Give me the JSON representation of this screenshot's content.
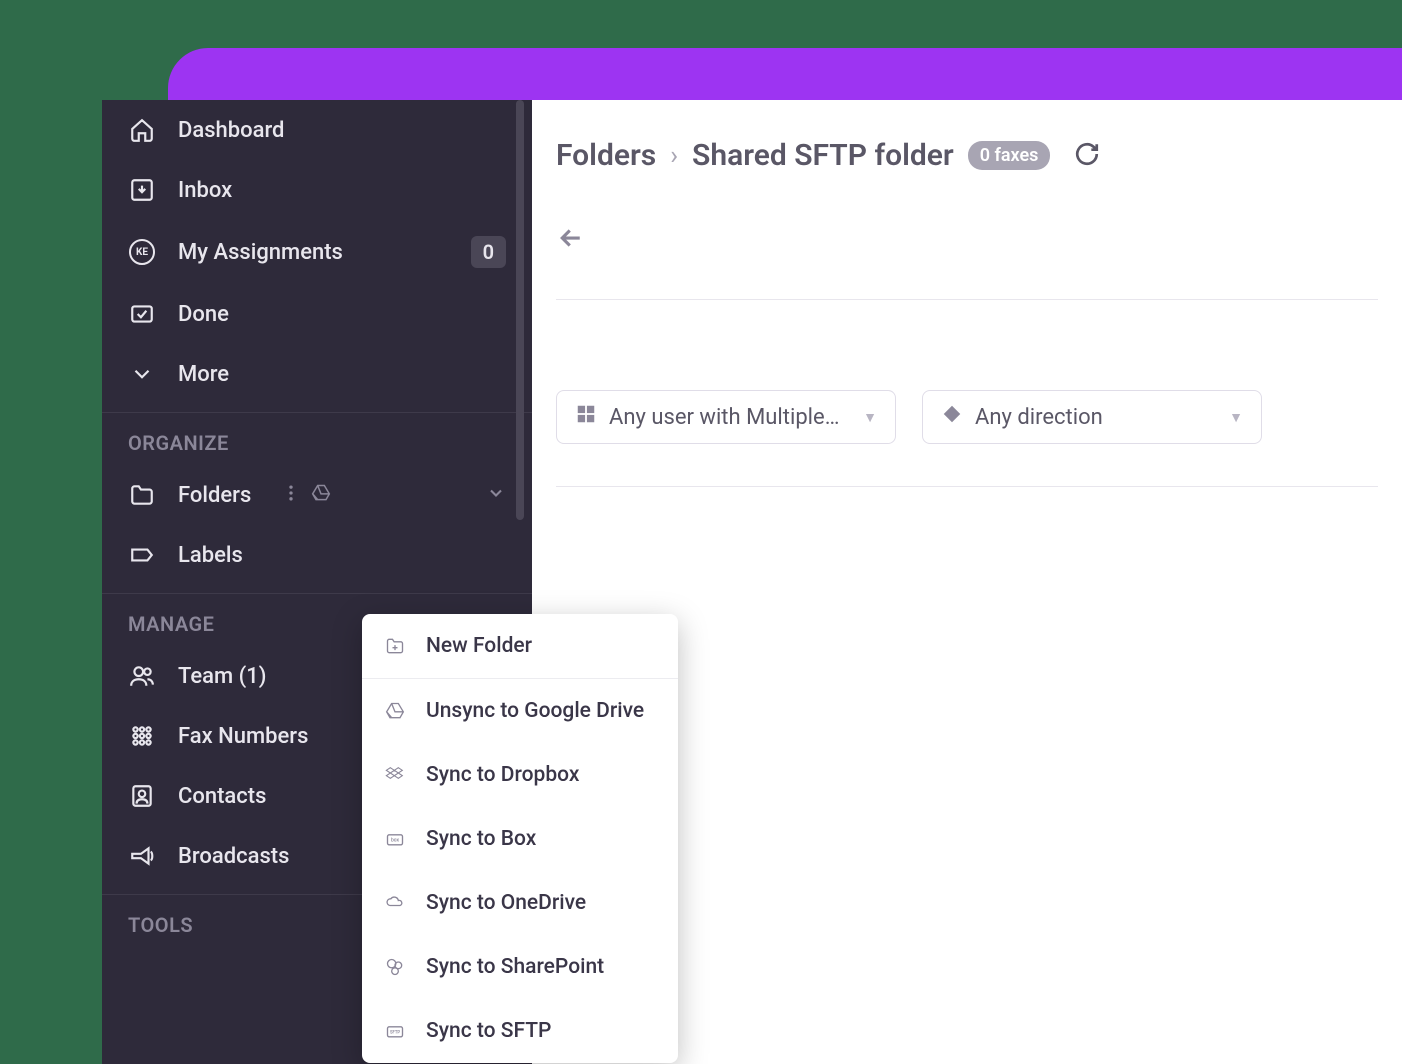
{
  "sidebar": {
    "nav": [
      {
        "label": "Dashboard",
        "icon": "home"
      },
      {
        "label": "Inbox",
        "icon": "inbox"
      },
      {
        "label": "My Assignments",
        "icon": "ke",
        "badge": "0"
      },
      {
        "label": "Done",
        "icon": "check"
      },
      {
        "label": "More",
        "icon": "chevron-down"
      }
    ],
    "sections": {
      "organize": {
        "title": "ORGANIZE",
        "items": [
          {
            "label": "Folders",
            "icon": "folder",
            "has_kebab": true,
            "has_drive": true,
            "expandable": true
          },
          {
            "label": "Labels",
            "icon": "tag"
          }
        ]
      },
      "manage": {
        "title": "MANAGE",
        "items": [
          {
            "label": "Team (1)",
            "icon": "team"
          },
          {
            "label": "Fax Numbers",
            "icon": "dialpad"
          },
          {
            "label": "Contacts",
            "icon": "contact"
          },
          {
            "label": "Broadcasts",
            "icon": "megaphone"
          }
        ]
      },
      "tools": {
        "title": "TOOLS"
      }
    }
  },
  "breadcrumb": {
    "root": "Folders",
    "current": "Shared SFTP folder",
    "badge": "0 faxes"
  },
  "filters": {
    "user": "Any user with Multiple ...",
    "direction": "Any direction"
  },
  "context_menu": [
    {
      "label": "New Folder",
      "icon": "new-folder"
    },
    {
      "label": "Unsync to Google Drive",
      "icon": "gdrive"
    },
    {
      "label": "Sync to Dropbox",
      "icon": "dropbox"
    },
    {
      "label": "Sync to Box",
      "icon": "box"
    },
    {
      "label": "Sync to OneDrive",
      "icon": "onedrive"
    },
    {
      "label": "Sync to SharePoint",
      "icon": "sharepoint"
    },
    {
      "label": "Sync to SFTP",
      "icon": "sftp"
    }
  ]
}
